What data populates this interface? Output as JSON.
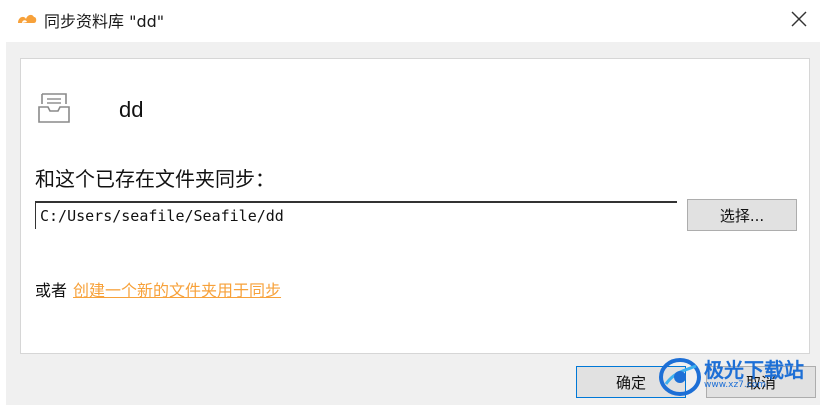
{
  "window": {
    "title": "同步资料库 \"dd\"",
    "close_icon": "close-icon",
    "app_icon": "seafile-logo-icon"
  },
  "library": {
    "icon": "library-tray-icon",
    "name": "dd"
  },
  "sync": {
    "label": "和这个已存在文件夹同步：",
    "path_value": "C:/Users/seafile/Seafile/dd",
    "choose_button_label": "选择..."
  },
  "alternative": {
    "or_text": "或者",
    "link_text": "创建一个新的文件夹用于同步",
    "link_color": "#f7a13a"
  },
  "footer": {
    "ok_label": "确定",
    "cancel_label": "取消"
  },
  "watermark": {
    "text": "极光下载站",
    "sub_text": "www.xz7.com"
  },
  "colors": {
    "accent": "#0078d7",
    "brand_orange": "#f7a13a"
  }
}
